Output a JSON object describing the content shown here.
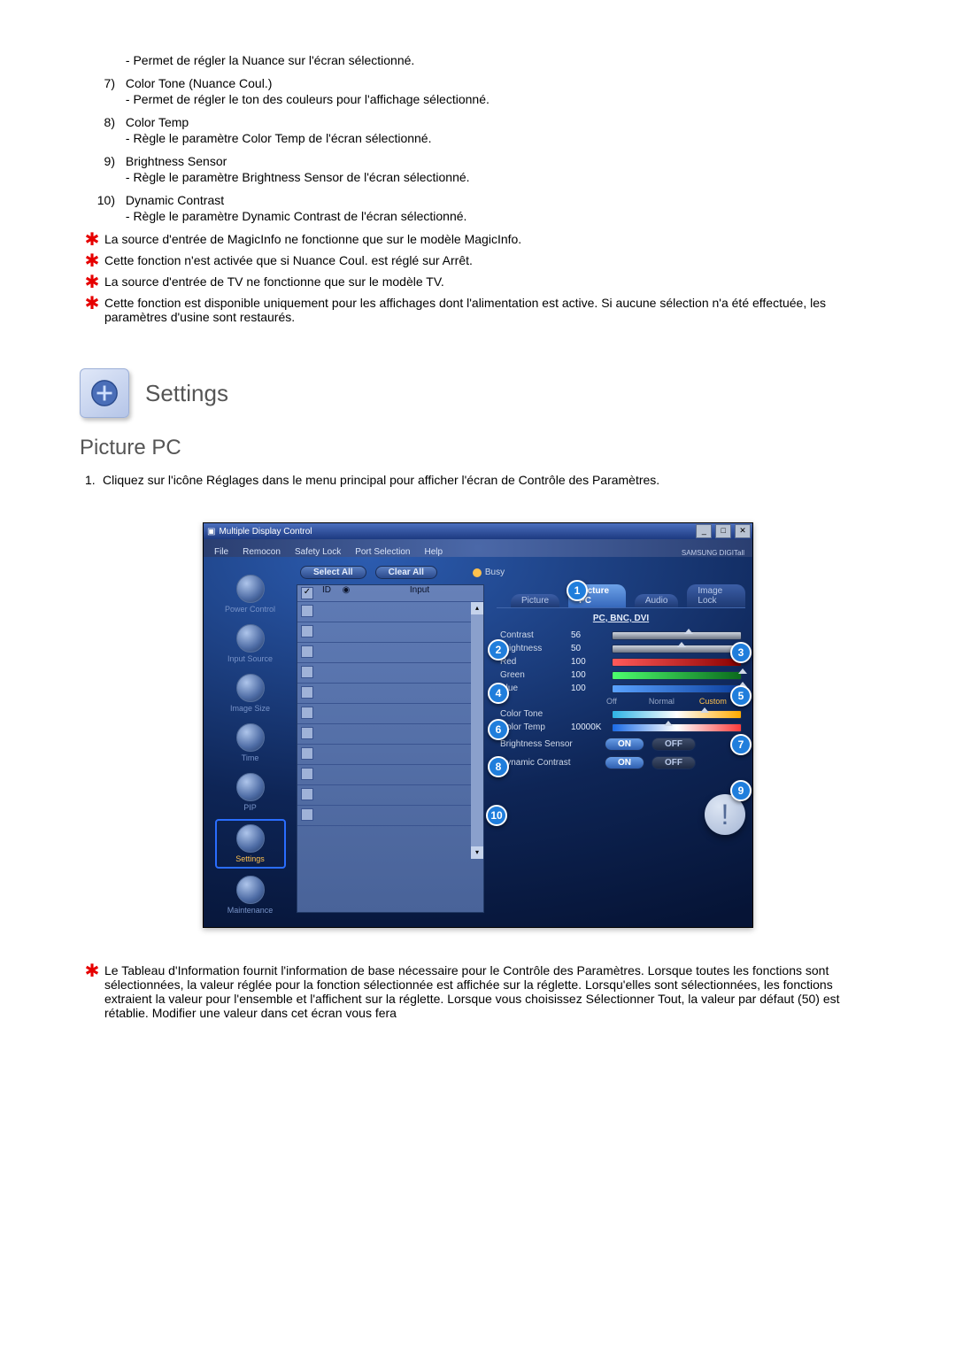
{
  "upper_list": [
    {
      "num": "",
      "title": "",
      "desc": "- Permet de régler la Nuance sur l'écran sélectionné."
    },
    {
      "num": "7)",
      "title": "Color Tone (Nuance Coul.)",
      "desc": "- Permet de régler le ton des couleurs pour l'affichage sélectionné."
    },
    {
      "num": "8)",
      "title": "Color Temp",
      "desc": "- Règle le paramètre Color Temp de l'écran sélectionné."
    },
    {
      "num": "9)",
      "title": "Brightness Sensor",
      "desc": "- Règle le paramètre Brightness Sensor de l'écran sélectionné."
    },
    {
      "num": "10)",
      "title": "Dynamic Contrast",
      "desc": "- Règle le paramètre Dynamic Contrast de l'écran sélectionné."
    }
  ],
  "star_notes": [
    "La source d'entrée de MagicInfo ne fonctionne que sur le modèle MagicInfo.",
    "Cette fonction n'est activée que si Nuance Coul. est réglé sur Arrêt.",
    "La source d'entrée de TV ne fonctionne que sur le modèle TV.",
    "Cette fonction est disponible uniquement pour les affichages dont l'alimentation est active. Si aucune sélection n'a été effectuée, les paramètres d'usine sont restaurés."
  ],
  "settings_heading": "Settings",
  "picturepc_heading": "Picture PC",
  "step1": "Cliquez sur l'icône Réglages dans le menu principal pour afficher l'écran de Contrôle des Paramètres.",
  "app": {
    "title": "Multiple Display Control",
    "menus": [
      "File",
      "Remocon",
      "Safety Lock",
      "Port Selection",
      "Help"
    ],
    "brand": "SAMSUNG DIGITall",
    "select_all": "Select All",
    "clear_all": "Clear All",
    "busy": "Busy",
    "grid_head": [
      "",
      "ID",
      "",
      "Input"
    ],
    "sidebar": [
      "Power Control",
      "Input Source",
      "Image Size",
      "Time",
      "PIP",
      "Settings",
      "Maintenance"
    ],
    "tabs": [
      "Picture",
      "Picture PC",
      "Audio",
      "Image Lock"
    ],
    "subhead": "PC, BNC, DVI",
    "params": {
      "contrast": {
        "label": "Contrast",
        "value": "56"
      },
      "brightness": {
        "label": "Brightness",
        "value": "50"
      },
      "red": {
        "label": "Red",
        "value": "100"
      },
      "green": {
        "label": "Green",
        "value": "100"
      },
      "blue": {
        "label": "Blue",
        "value": "100"
      },
      "colortone": {
        "label": "Color Tone"
      },
      "tone_options": [
        "Off",
        "Normal",
        "Custom"
      ],
      "colortemp": {
        "label": "Color Temp",
        "value": "10000K"
      },
      "brightness_sensor": "Brightness Sensor",
      "dynamic_contrast": "Dynamic Contrast",
      "on": "ON",
      "off": "OFF"
    }
  },
  "footer_note": "Le Tableau d'Information fournit l'information de base nécessaire pour le Contrôle des Paramètres. Lorsque toutes les fonctions sont sélectionnées, la valeur réglée pour la fonction sélectionnée est affichée sur la réglette. Lorsqu'elles sont sélectionnées, les fonctions extraient la valeur pour l'ensemble et l'affichent sur la réglette. Lorsque vous choisissez Sélectionner Tout, la valeur par défaut (50) est rétablie. Modifier une valeur dans cet écran vous fera"
}
